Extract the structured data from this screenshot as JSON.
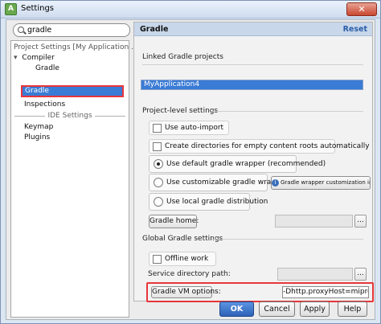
{
  "window": {
    "title": "Settings",
    "app_icon": "android-studio-icon",
    "close_label": "✕"
  },
  "search": {
    "value": "gradle"
  },
  "tree": {
    "project_section": "Project Settings [My Application ...",
    "compiler": "Compiler",
    "compiler_child": "Gradle",
    "gradle_selected": "Gradle",
    "inspections": "Inspections",
    "ide_section": "IDE Settings",
    "keymap": "Keymap",
    "plugins": "Plugins"
  },
  "panel": {
    "title": "Gradle",
    "reset": "Reset",
    "linked_label": "Linked Gradle projects",
    "linked_project": "MyApplication4",
    "project_level_label": "Project-level settings",
    "use_auto_import": "Use auto-import",
    "create_dirs": "Create directories for empty content roots automatically",
    "default_wrapper": "Use default gradle wrapper (recommended)",
    "customizable_wrapper": "Use customizable gradle wrapper",
    "wrapper_customization_hint": "Gradle wrapper customization in s...",
    "local_distribution": "Use local gradle distribution",
    "gradle_home_button": "Gradle home:",
    "global_label": "Global Gradle settings",
    "offline_work": "Offline work",
    "service_dir_label": "Service directory path:",
    "vm_options_button": "Gradle VM options:",
    "vm_options_value": "-Dhttp.proxyHost=miproxy.",
    "browse_label": "..."
  },
  "footer": {
    "ok": "OK",
    "cancel": "Cancel",
    "apply": "Apply",
    "help": "Help"
  },
  "colors": {
    "accent": "#3a7bd5",
    "highlight": "#e8353a",
    "link": "#2a5ea8"
  }
}
